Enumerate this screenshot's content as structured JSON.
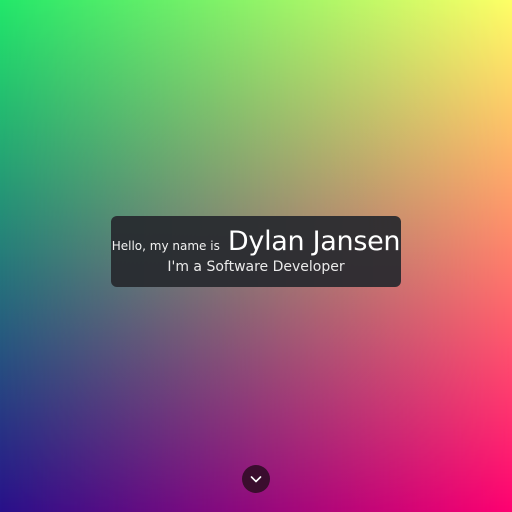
{
  "intro": {
    "greeting": "Hello, my name is",
    "name": "Dylan Jansen",
    "role": "I'm a Software Developer"
  },
  "scroll_button": {
    "icon": "chevron-down-icon"
  },
  "colors": {
    "gradient_green": "#22e86a",
    "gradient_yellow": "#ffff66",
    "gradient_blue": "#28108a",
    "gradient_pink": "#ff0070",
    "card_background": "#26282e",
    "button_background": "#3a0d2e"
  }
}
